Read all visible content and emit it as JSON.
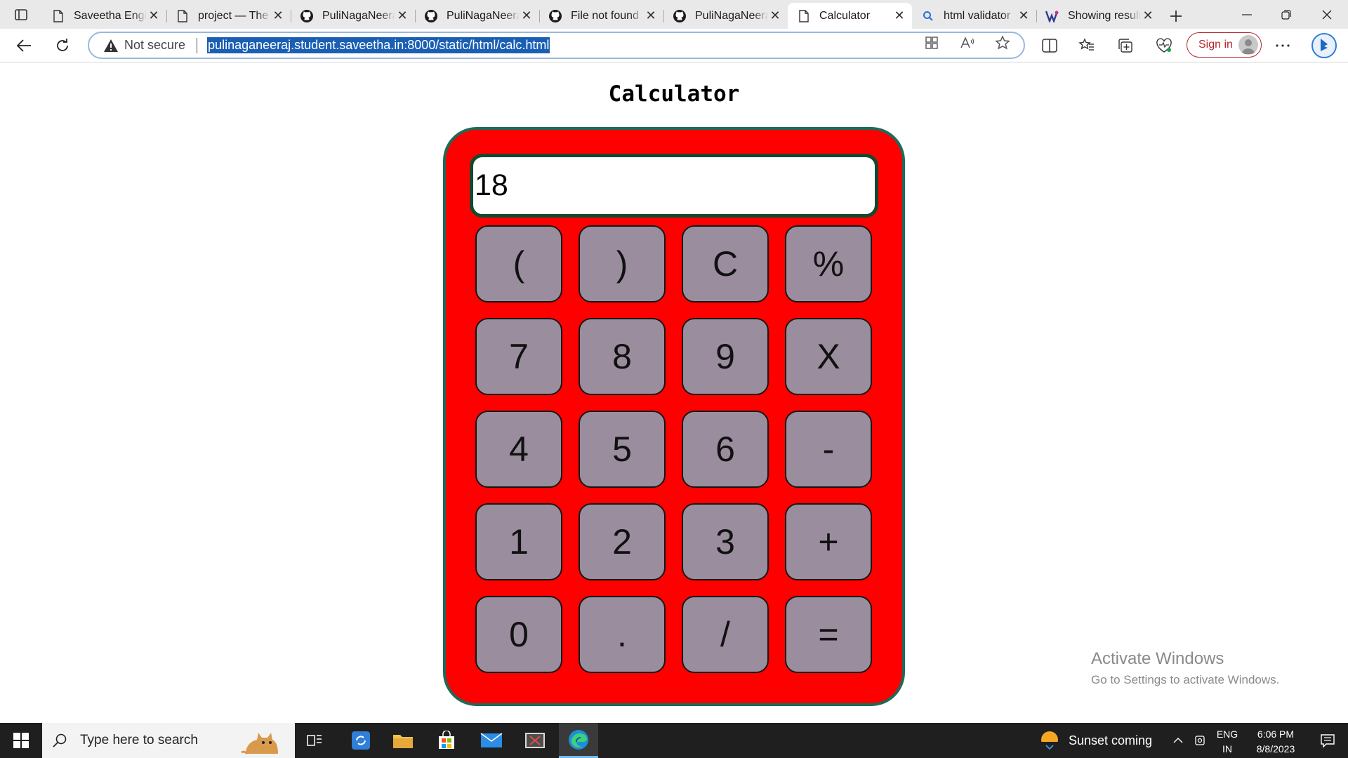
{
  "browser": {
    "tabs": [
      {
        "label": "Saveetha Engineering",
        "icon": "page-icon"
      },
      {
        "label": "project — The Tower",
        "icon": "page-icon"
      },
      {
        "label": "PuliNagaNeeraj",
        "icon": "github-icon"
      },
      {
        "label": "PuliNagaNeeraj",
        "icon": "github-icon"
      },
      {
        "label": "File not found",
        "icon": "github-icon"
      },
      {
        "label": "PuliNagaNeeraj",
        "icon": "github-icon"
      },
      {
        "label": "Calculator",
        "icon": "page-icon",
        "active": true
      },
      {
        "label": "html validator",
        "icon": "search-icon"
      },
      {
        "label": "Showing results",
        "icon": "validator-icon"
      }
    ],
    "address": {
      "security_label": "Not secure",
      "url": "pulinaganeeraj.student.saveetha.in:8000/static/html/calc.html"
    },
    "sign_in_label": "Sign in",
    "colors": {
      "accent": "#1a5fb4",
      "signin": "#b3262e"
    }
  },
  "page": {
    "title": "Calculator",
    "display_value": "18",
    "keys": [
      "(",
      ")",
      "C",
      "%",
      "7",
      "8",
      "9",
      "X",
      "4",
      "5",
      "6",
      "-",
      "1",
      "2",
      "3",
      "+",
      "0",
      ".",
      "/",
      "="
    ],
    "colors": {
      "body": "#ff0000",
      "border": "#1d6a59",
      "key": "#9a8d9e",
      "display_border": "#114a2f"
    }
  },
  "watermark": {
    "line1": "Activate Windows",
    "line2": "Go to Settings to activate Windows."
  },
  "taskbar": {
    "search_placeholder": "Type here to search",
    "weather": "Sunset coming",
    "lang_top": "ENG",
    "lang_bottom": "IN",
    "time": "6:06 PM",
    "date": "8/8/2023"
  }
}
